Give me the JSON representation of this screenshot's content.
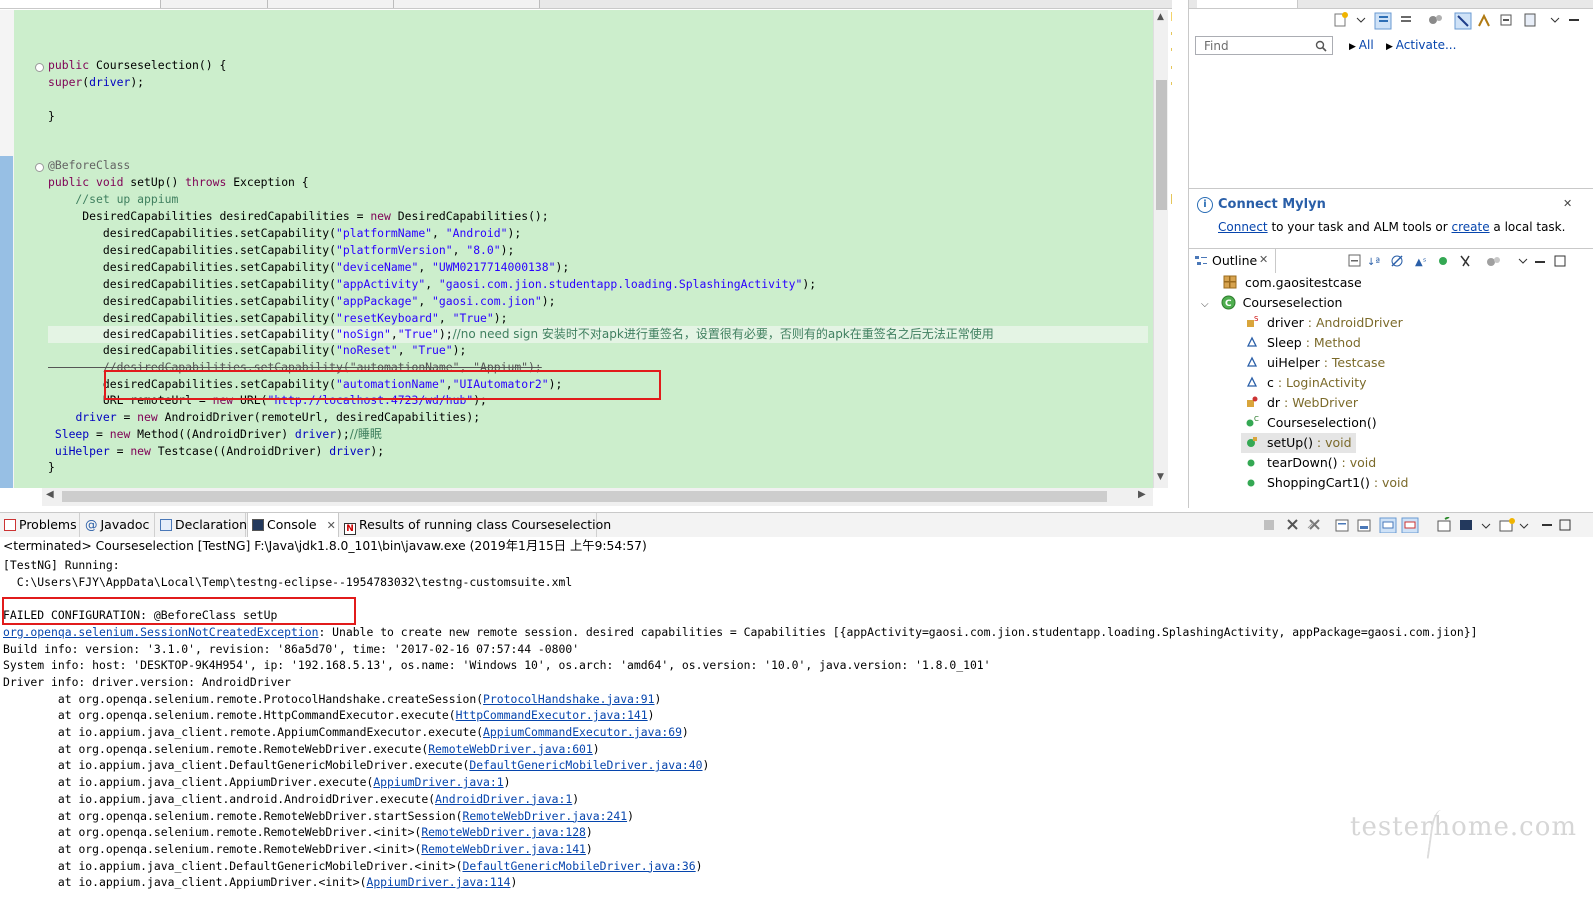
{
  "editor": {
    "code_lines": [
      {
        "parts": [
          [
            "kw",
            "public "
          ],
          [
            "tp",
            "Courseselection() {"
          ]
        ]
      },
      {
        "parts": [
          [
            "kw",
            "super"
          ],
          [
            "tp",
            "("
          ],
          [
            "fld",
            "driver"
          ],
          [
            "tp",
            ");"
          ]
        ]
      },
      {
        "parts": [
          [
            "tp",
            "}"
          ]
        ]
      },
      {
        "parts": [
          [
            "ann",
            "@BeforeClass"
          ]
        ]
      },
      {
        "parts": [
          [
            "kw",
            "public void "
          ],
          [
            "tp",
            "setUp() "
          ],
          [
            "kw",
            "throws "
          ],
          [
            "tp",
            "Exception {"
          ]
        ]
      },
      {
        "parts": [
          [
            "cmt",
            "    //set up appium"
          ]
        ]
      },
      {
        "parts": [
          [
            "tp",
            "     DesiredCapabilities desiredCapabilities = "
          ],
          [
            "kw",
            "new "
          ],
          [
            "tp",
            "DesiredCapabilities();"
          ]
        ]
      },
      {
        "parts": [
          [
            "tp",
            "        desiredCapabilities.setCapability("
          ],
          [
            "str",
            "\"platformName\""
          ],
          [
            "tp",
            ", "
          ],
          [
            "str",
            "\"Android\""
          ],
          [
            "tp",
            ");"
          ]
        ]
      },
      {
        "parts": [
          [
            "tp",
            "        desiredCapabilities.setCapability("
          ],
          [
            "str",
            "\"platformVersion\""
          ],
          [
            "tp",
            ", "
          ],
          [
            "str",
            "\"8.0\""
          ],
          [
            "tp",
            ");"
          ]
        ]
      },
      {
        "parts": [
          [
            "tp",
            "        desiredCapabilities.setCapability("
          ],
          [
            "str",
            "\"deviceName\""
          ],
          [
            "tp",
            ", "
          ],
          [
            "str",
            "\"UWM0217714000138\""
          ],
          [
            "tp",
            ");"
          ]
        ]
      },
      {
        "parts": [
          [
            "tp",
            "        desiredCapabilities.setCapability("
          ],
          [
            "str",
            "\"appActivity\""
          ],
          [
            "tp",
            ", "
          ],
          [
            "str",
            "\"gaosi.com.jion.studentapp.loading.SplashingActivity\""
          ],
          [
            "tp",
            ");"
          ]
        ]
      },
      {
        "parts": [
          [
            "tp",
            "        desiredCapabilities.setCapability("
          ],
          [
            "str",
            "\"appPackage\""
          ],
          [
            "tp",
            ", "
          ],
          [
            "str",
            "\"gaosi.com.jion\""
          ],
          [
            "tp",
            ");"
          ]
        ]
      },
      {
        "parts": [
          [
            "tp",
            "        desiredCapabilities.setCapability("
          ],
          [
            "str",
            "\"resetKeyboard\""
          ],
          [
            "tp",
            ", "
          ],
          [
            "str",
            "\"True\""
          ],
          [
            "tp",
            ");"
          ]
        ]
      },
      {
        "parts": [
          [
            "tp",
            "        desiredCapabilities.setCapability("
          ],
          [
            "str",
            "\"noSign\""
          ],
          [
            "tp",
            ","
          ],
          [
            "str",
            "\"True\""
          ],
          [
            "tp",
            ");"
          ],
          [
            "cmt",
            "//no need sign 安装时不对apk进行重签名，设置很有必要，否则有的apk在重签名之后无法正常使用"
          ]
        ]
      },
      {
        "parts": [
          [
            "tp",
            "        desiredCapabilities.setCapability("
          ],
          [
            "str",
            "\"noReset\""
          ],
          [
            "tp",
            ", "
          ],
          [
            "str",
            "\"True\""
          ],
          [
            "tp",
            ");"
          ]
        ]
      },
      {
        "parts": [
          [
            "cmt",
            "        //desiredCapabilities.setCapability(\"automationName\", \"Appium\");"
          ]
        ]
      },
      {
        "parts": [
          [
            "tp",
            "        desiredCapabilities.setCapability("
          ],
          [
            "str",
            "\"automationName\""
          ],
          [
            "tp",
            ","
          ],
          [
            "str",
            "\"UIAutomator2\""
          ],
          [
            "tp",
            ");"
          ]
        ]
      },
      {
        "parts": [
          [
            "tp",
            "        URL remoteUrl = "
          ],
          [
            "kw",
            "new "
          ],
          [
            "tp",
            "URL("
          ],
          [
            "str",
            "\"http://localhost:4723/wd/hub\""
          ],
          [
            "tp",
            ");"
          ]
        ]
      },
      {
        "parts": [
          [
            "tp",
            "    "
          ],
          [
            "fld",
            "driver"
          ],
          [
            "tp",
            " = "
          ],
          [
            "kw",
            "new "
          ],
          [
            "tp",
            "AndroidDriver(remoteUrl, desiredCapabilities);"
          ]
        ]
      },
      {
        "parts": [
          [
            "tp",
            " "
          ],
          [
            "fld",
            "Sleep"
          ],
          [
            "tp",
            " = "
          ],
          [
            "kw",
            "new "
          ],
          [
            "tp",
            "Method(("
          ],
          [
            "tp",
            "AndroidDriver"
          ],
          [
            "tp",
            ") "
          ],
          [
            "fld",
            "driver"
          ],
          [
            "tp",
            ");"
          ],
          [
            "cmt",
            "//睡眠"
          ]
        ]
      },
      {
        "parts": [
          [
            "tp",
            " "
          ],
          [
            "fld",
            "uiHelper"
          ],
          [
            "tp",
            " = "
          ],
          [
            "kw",
            "new "
          ],
          [
            "tp",
            "Testcase(("
          ],
          [
            "tp",
            "AndroidDriver"
          ],
          [
            "tp",
            ") "
          ],
          [
            "fld",
            "driver"
          ],
          [
            "tp",
            ");"
          ]
        ]
      },
      {
        "parts": [
          [
            "tp",
            "}"
          ]
        ]
      }
    ]
  },
  "tasks": {
    "find_placeholder": "Find",
    "all_label": "All",
    "activate_label": "Activate..."
  },
  "mylyn": {
    "title": "Connect Mylyn",
    "connect_link": "Connect",
    "text_middle": " to your task and ALM tools or ",
    "create_link": "create",
    "text_end": " a local task."
  },
  "outline": {
    "tab_label": "Outline",
    "items": [
      {
        "name": "com.gaositestcase",
        "type": ""
      },
      {
        "name": "Courseselection",
        "type": ""
      },
      {
        "name": "driver",
        "type": " : AndroidDriver"
      },
      {
        "name": "Sleep",
        "type": " : Method"
      },
      {
        "name": "uiHelper",
        "type": " : Testcase"
      },
      {
        "name": "c",
        "type": " : LoginActivity"
      },
      {
        "name": "dr",
        "type": " : WebDriver"
      },
      {
        "name": "Courseselection()",
        "type": ""
      },
      {
        "name": "setUp()",
        "type": " : void"
      },
      {
        "name": "tearDown()",
        "type": " : void"
      },
      {
        "name": "ShoppingCart1()",
        "type": " : void"
      }
    ]
  },
  "bottom_tabs": [
    "Problems",
    "Javadoc",
    "Declaration",
    "Console",
    "Results of running class Courseselection"
  ],
  "console": {
    "status": "<terminated> Courseselection [TestNG] F:\\Java\\jdk1.8.0_101\\bin\\javaw.exe (2019年1月15日 上午9:54:57)",
    "lines": [
      {
        "text": "[TestNG] Running:"
      },
      {
        "text": "  C:\\Users\\FJY\\AppData\\Local\\Temp\\testng-eclipse--1954783032\\testng-customsuite.xml"
      },
      {
        "text": ""
      },
      {
        "text": "FAILED CONFIGURATION: @BeforeClass setUp"
      },
      {
        "link": "org.openqa.selenium.SessionNotCreatedException",
        "text": ": Unable to create new remote session. desired capabilities = Capabilities [{appActivity=gaosi.com.jion.studentapp.loading.SplashingActivity, appPackage=gaosi.com.jion}]"
      },
      {
        "text": "Build info: version: '3.1.0', revision: '86a5d70', time: '2017-02-16 07:57:44 -0800'"
      },
      {
        "text": "System info: host: 'DESKTOP-9K4H954', ip: '192.168.5.13', os.name: 'Windows 10', os.arch: 'amd64', os.version: '10.0', java.version: '1.8.0_101'"
      },
      {
        "text": "Driver info: driver.version: AndroidDriver"
      },
      {
        "at": "org.openqa.selenium.remote.ProtocolHandshake.createSession",
        "src": "ProtocolHandshake.java:91"
      },
      {
        "at": "org.openqa.selenium.remote.HttpCommandExecutor.execute",
        "src": "HttpCommandExecutor.java:141"
      },
      {
        "at": "io.appium.java_client.remote.AppiumCommandExecutor.execute",
        "src": "AppiumCommandExecutor.java:69"
      },
      {
        "at": "org.openqa.selenium.remote.RemoteWebDriver.execute",
        "src": "RemoteWebDriver.java:601"
      },
      {
        "at": "io.appium.java_client.DefaultGenericMobileDriver.execute",
        "src": "DefaultGenericMobileDriver.java:40"
      },
      {
        "at": "io.appium.java_client.AppiumDriver.execute",
        "src": "AppiumDriver.java:1"
      },
      {
        "at": "io.appium.java_client.android.AndroidDriver.execute",
        "src": "AndroidDriver.java:1"
      },
      {
        "at": "org.openqa.selenium.remote.RemoteWebDriver.startSession",
        "src": "RemoteWebDriver.java:241"
      },
      {
        "at": "org.openqa.selenium.remote.RemoteWebDriver.<init>",
        "src": "RemoteWebDriver.java:128"
      },
      {
        "at": "org.openqa.selenium.remote.RemoteWebDriver.<init>",
        "src": "RemoteWebDriver.java:141"
      },
      {
        "at": "io.appium.java_client.DefaultGenericMobileDriver.<init>",
        "src": "DefaultGenericMobileDriver.java:36"
      },
      {
        "at": "io.appium.java_client.AppiumDriver.<init>",
        "src": "AppiumDriver.java:114"
      }
    ],
    "at_prefix": "        at "
  },
  "watermark": "testerhome.com",
  "colors": {
    "highlight_box": "#e11b1b",
    "editor_bg": "#cceecc",
    "link": "#0645ad"
  }
}
